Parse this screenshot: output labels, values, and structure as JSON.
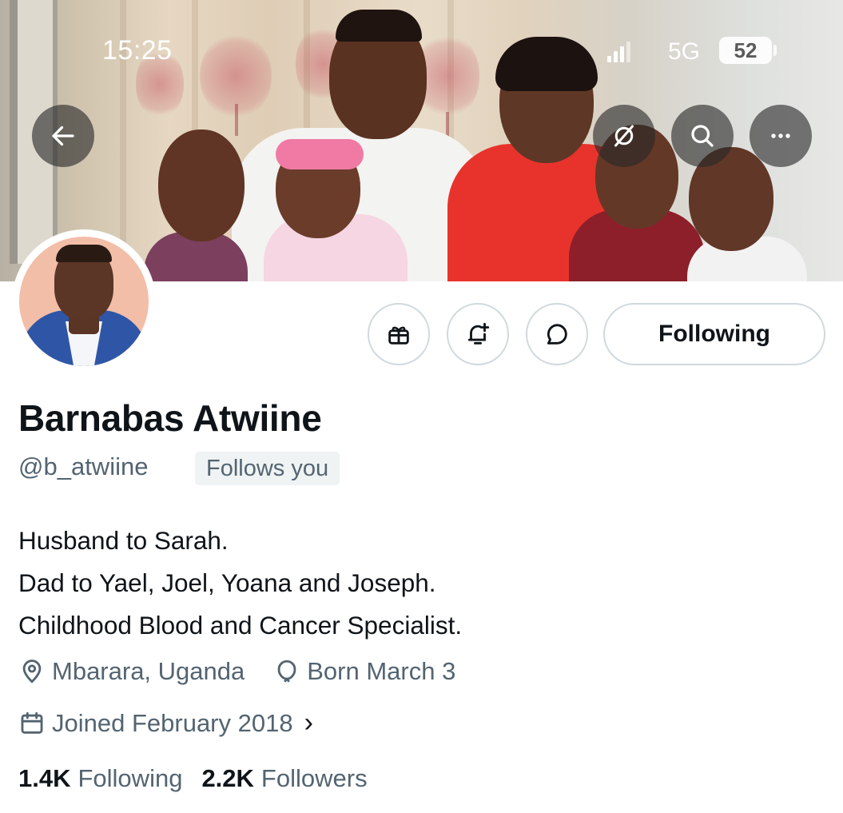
{
  "status_bar": {
    "time": "15:25",
    "network": "5G",
    "battery": "52"
  },
  "banner": {
    "back_icon": "arrow-left-icon",
    "overlay_icons": [
      "satellite-off-icon",
      "search-icon",
      "more-icon"
    ]
  },
  "actions": {
    "icons": [
      "gift-icon",
      "bell-plus-icon",
      "message-bubble-icon"
    ],
    "following_label": "Following"
  },
  "profile": {
    "display_name": "Barnabas Atwiine",
    "handle": "@b_atwiine",
    "follows_you": "Follows you",
    "bio": [
      "Husband to Sarah.",
      "Dad to Yael, Joel, Yoana and Joseph.",
      "Childhood Blood and Cancer Specialist."
    ],
    "location": "Mbarara, Uganda",
    "birthday": "Born March 3",
    "joined": "Joined February 2018",
    "joined_chevron": "›"
  },
  "stats": {
    "following_count": "1.4K",
    "following_label": "Following",
    "followers_count": "2.2K",
    "followers_label": "Followers"
  },
  "colors": {
    "text_primary": "#0f1419",
    "text_secondary": "#536471",
    "border": "#cfd9de",
    "badge_bg": "#eff3f4"
  }
}
